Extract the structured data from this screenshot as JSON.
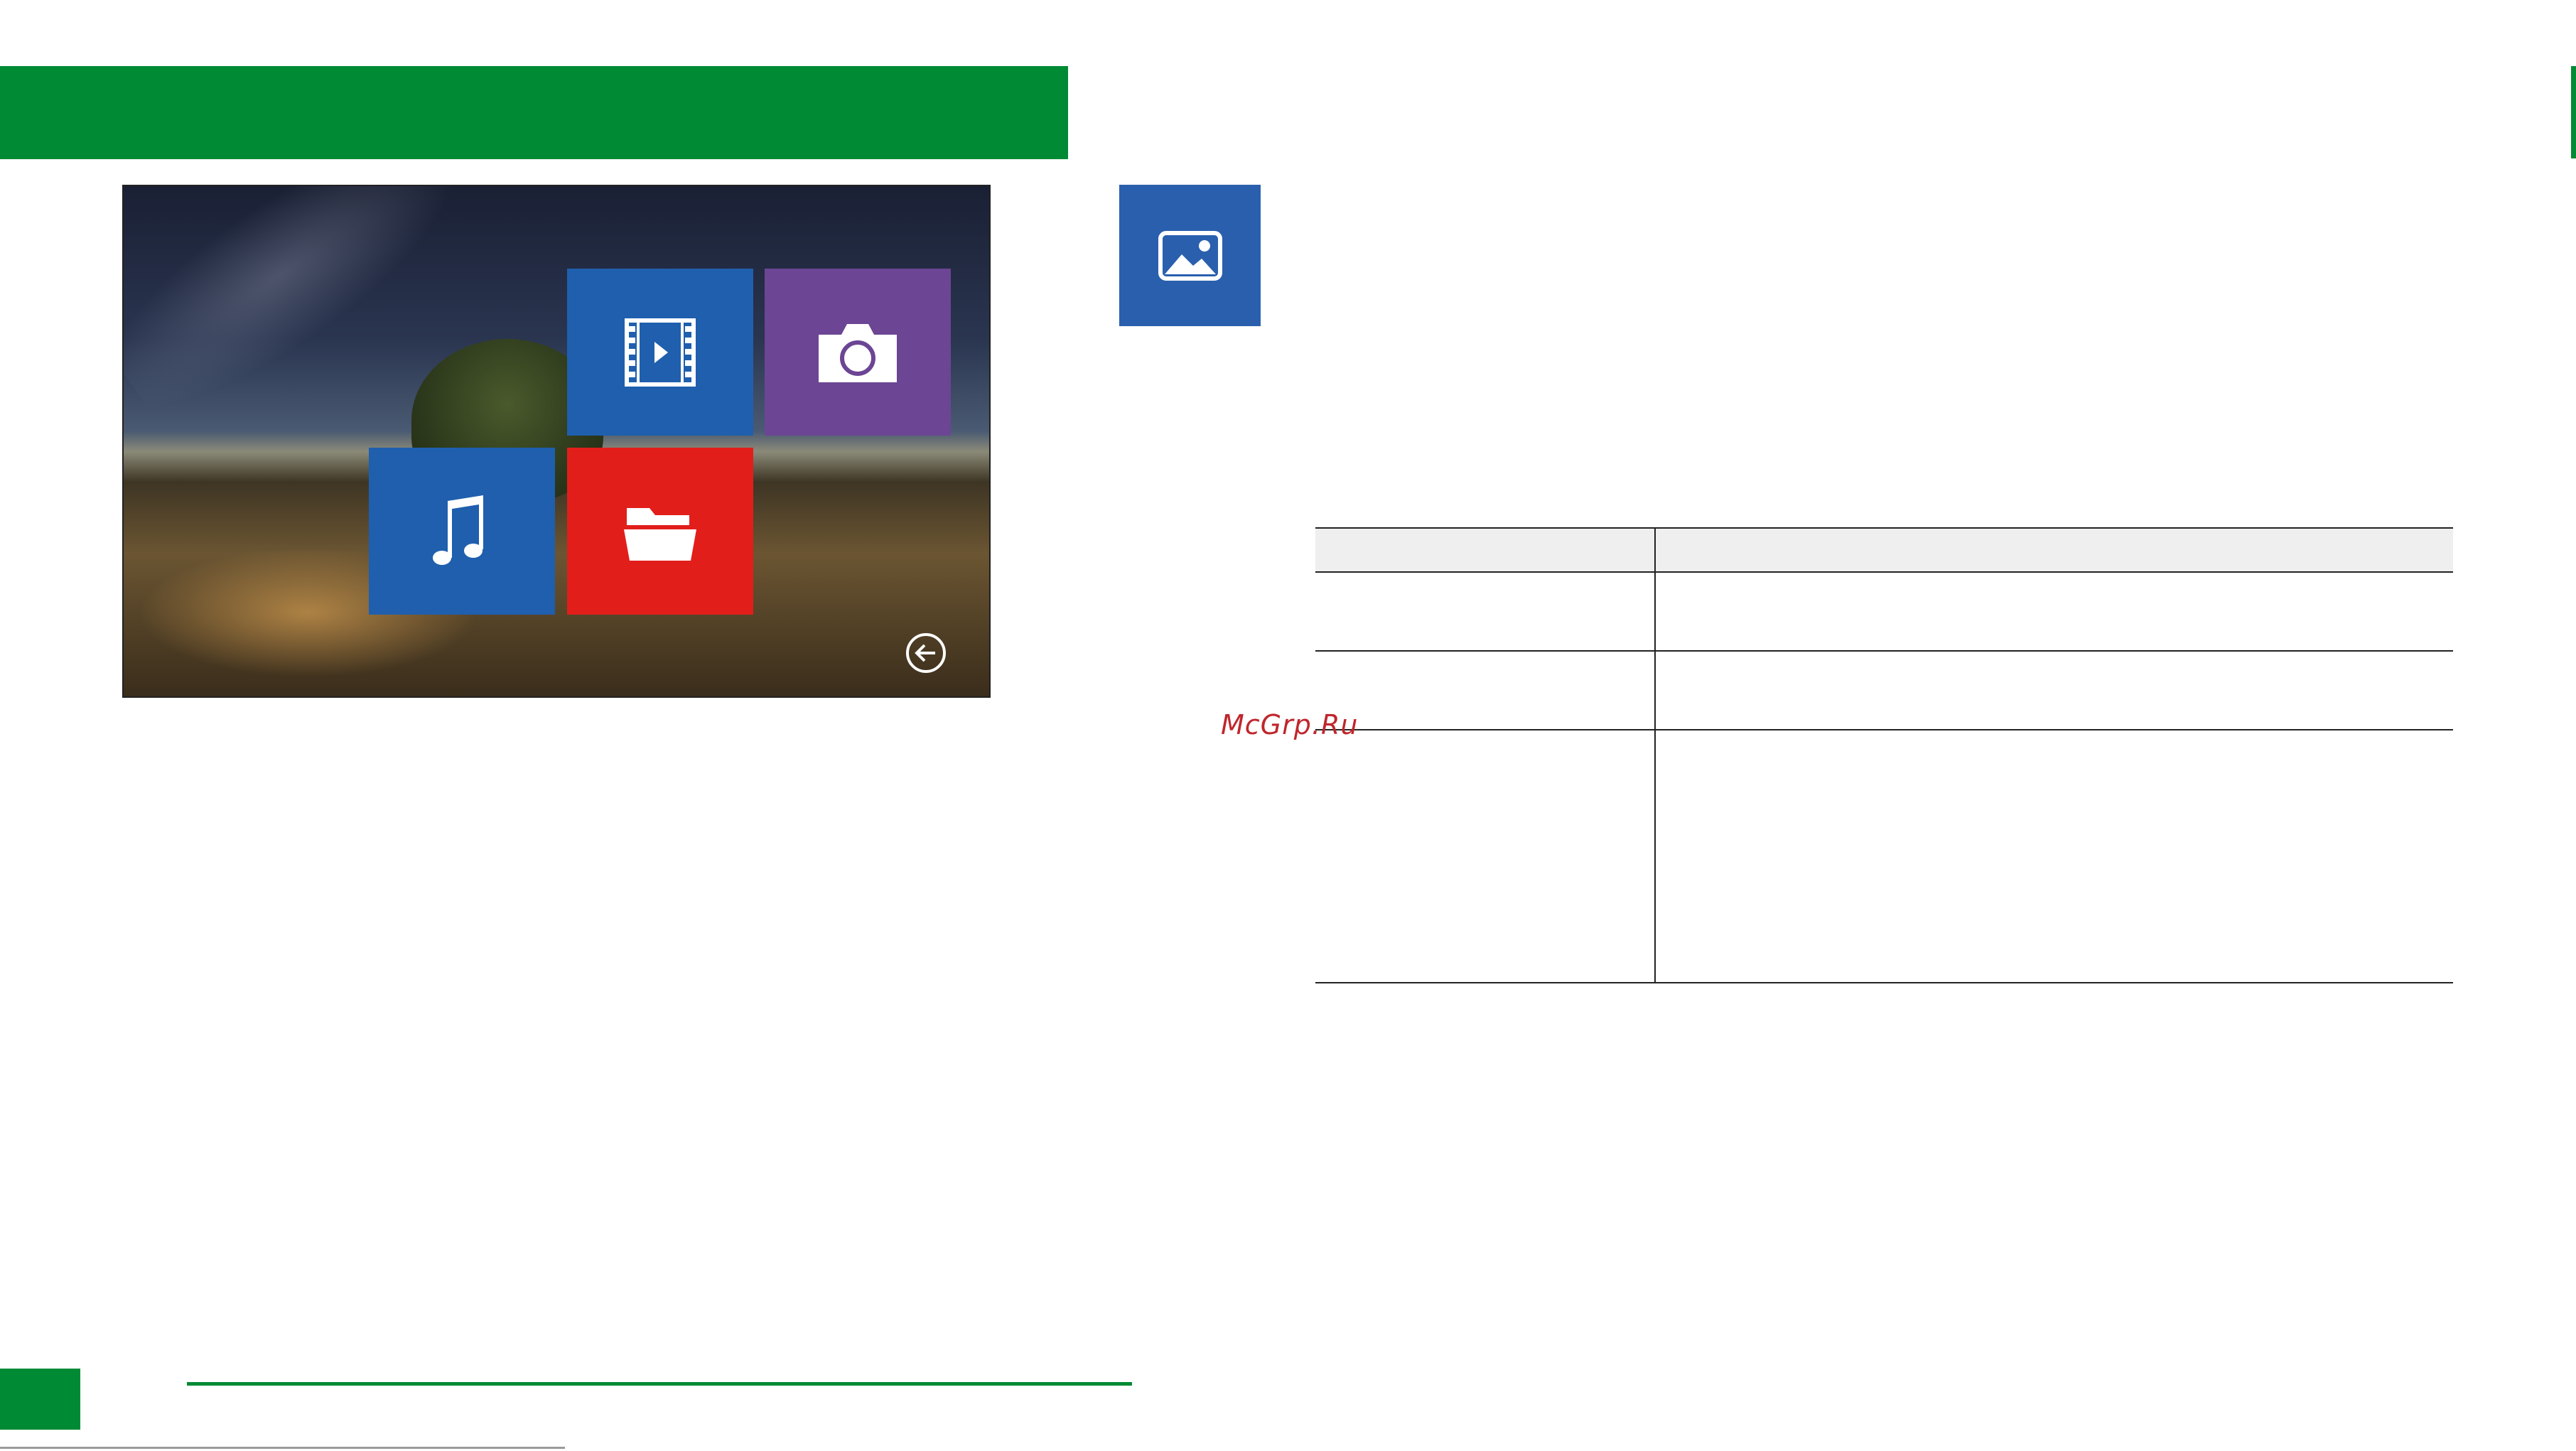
{
  "colors": {
    "brand_green": "#008a34",
    "tile_blue": "#1f5fae",
    "tile_purple": "#6c4594",
    "tile_red": "#e21e1b",
    "photo_blue": "#2a5fae",
    "watermark_red": "#c0262c"
  },
  "screen": {
    "tiles": [
      {
        "name": "video",
        "icon": "film-play-icon"
      },
      {
        "name": "photo",
        "icon": "camera-icon"
      },
      {
        "name": "music",
        "icon": "music-note-icon"
      },
      {
        "name": "folder",
        "icon": "open-folder-icon"
      }
    ],
    "back_icon": "back-arrow-icon"
  },
  "photo_icon": "image-icon",
  "watermark": "McGrp.Ru"
}
